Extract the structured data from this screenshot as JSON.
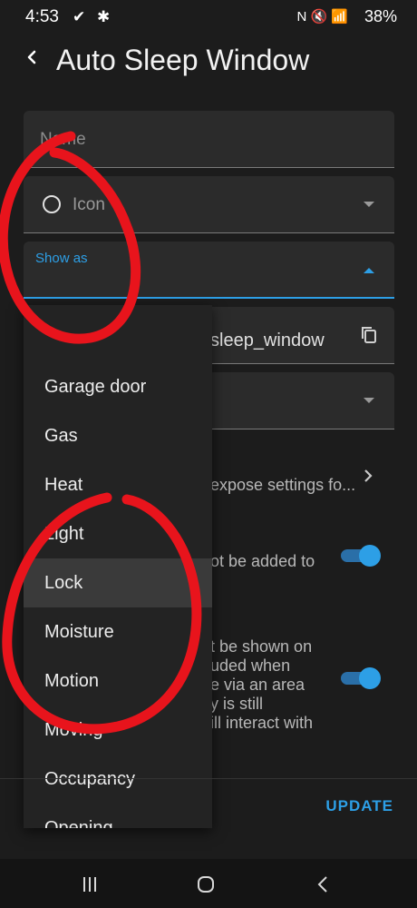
{
  "status_bar": {
    "time": "4:53",
    "left_icons": "✔ ✱",
    "right_icons": "N 🔇 📶",
    "battery": "38%"
  },
  "header": {
    "title": "Auto Sleep Window",
    "back_icon": "chevron-left-icon"
  },
  "form": {
    "name_placeholder": "Name",
    "icon_label": "Icon",
    "show_as_label": "Show as",
    "entity_id_suffix": "sleep_window",
    "expose_text": "expose settings fo...",
    "notadded_text": "ot be added to",
    "area_text_lines": [
      "t be shown on",
      "uded when",
      "e via an area",
      "y is still",
      "ill interact with"
    ],
    "update_label": "UPDATE"
  },
  "dropdown": {
    "items": [
      "Garage door",
      "Gas",
      "Heat",
      "Light",
      "Lock",
      "Moisture",
      "Motion",
      "Moving",
      "Occupancy",
      "Opening"
    ],
    "highlighted": "Lock"
  },
  "colors": {
    "accent": "#2d9fe6",
    "annotation": "#e8141c",
    "background": "#1c1c1c"
  }
}
